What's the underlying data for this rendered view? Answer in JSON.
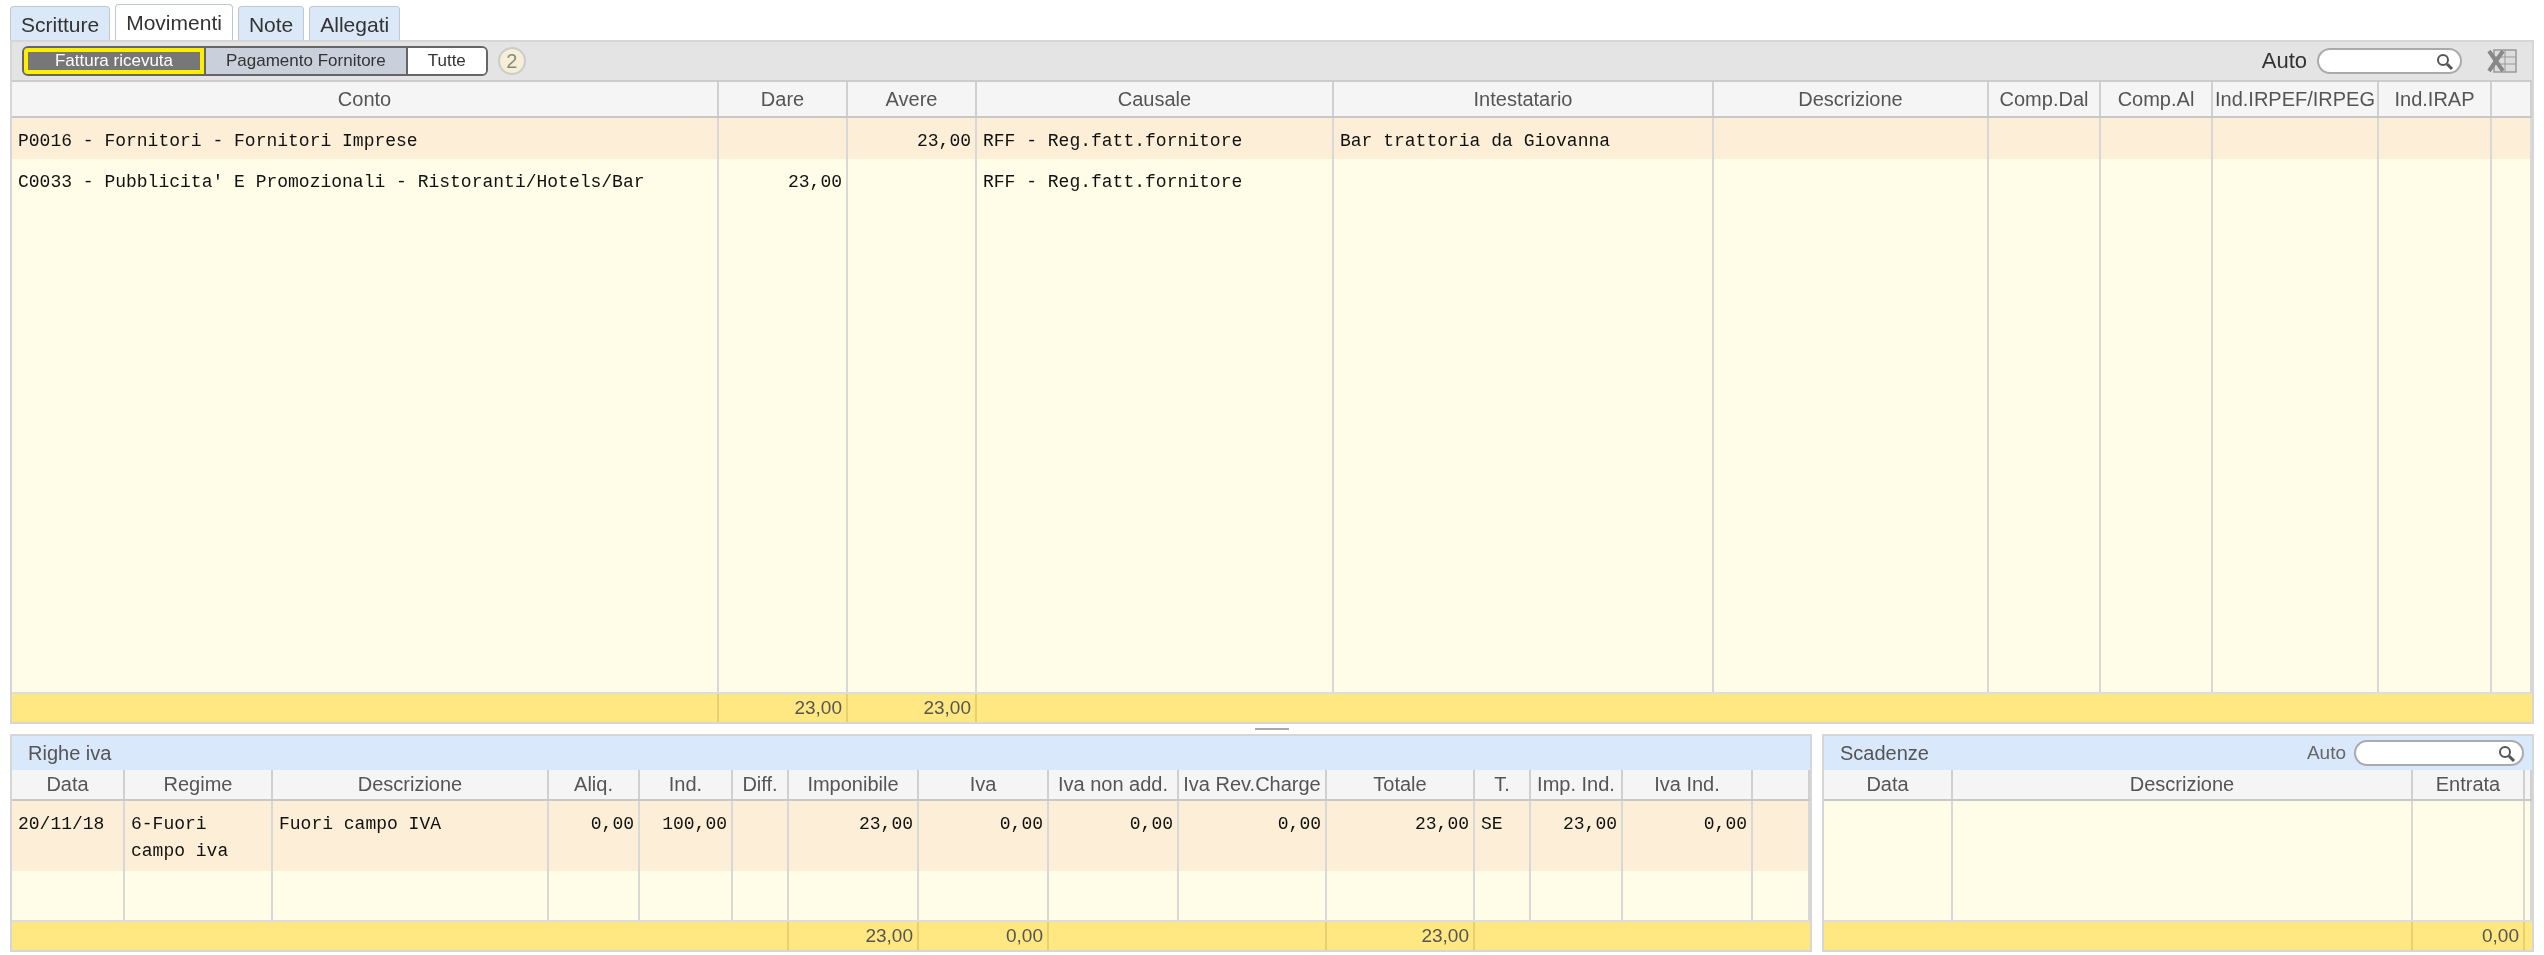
{
  "tabs": [
    {
      "label": "Scritture",
      "selected": false
    },
    {
      "label": "Movimenti",
      "selected": true
    },
    {
      "label": "Note",
      "selected": false
    },
    {
      "label": "Allegati",
      "selected": false
    }
  ],
  "filters": [
    {
      "label": "Fattura ricevuta",
      "selected": true
    },
    {
      "label": "Pagamento Fornitore",
      "selected": false
    },
    {
      "label": "Tutte",
      "selected": false
    }
  ],
  "count_badge": "2",
  "search": {
    "label": "Auto"
  },
  "movements": {
    "columns": [
      {
        "label": "Conto",
        "kind": "text"
      },
      {
        "label": "Dare",
        "kind": "amount",
        "total": "23,00"
      },
      {
        "label": "Avere",
        "kind": "amount",
        "total": "23,00"
      },
      {
        "label": "Causale",
        "kind": "text"
      },
      {
        "label": "Intestatario",
        "kind": "text"
      },
      {
        "label": "Descrizione"
      },
      {
        "label": "Comp.Dal"
      },
      {
        "label": "Comp.Al"
      },
      {
        "label": "Ind.IRPEF/IRPEG"
      },
      {
        "label": "Ind.IRAP"
      }
    ],
    "rows": [
      {
        "selected": true,
        "cells": [
          "P0016 - Fornitori - Fornitori Imprese",
          null,
          "23,00",
          "RFF - Reg.fatt.fornitore",
          "Bar trattoria da Giovanna"
        ]
      },
      {
        "selected": false,
        "cells": [
          "C0033 - Pubblicita' E Promozionali - Ristoranti/Hotels/Bar",
          "23,00",
          null,
          "RFF - Reg.fatt.fornitore"
        ]
      }
    ]
  },
  "vat_lines": {
    "title": "Righe iva",
    "columns": [
      {
        "label": "Data",
        "kind": "text"
      },
      {
        "label": "Regime",
        "kind": "text"
      },
      {
        "label": "Descrizione",
        "kind": "text"
      },
      {
        "label": "Aliq.",
        "kind": "amount"
      },
      {
        "label": "Ind.",
        "kind": "amount"
      },
      {
        "label": "Diff."
      },
      {
        "label": "Imponibile",
        "kind": "amount",
        "total": "23,00"
      },
      {
        "label": "Iva",
        "kind": "amount",
        "total": "0,00"
      },
      {
        "label": "Iva non add.",
        "kind": "amount"
      },
      {
        "label": "Iva Rev.Charge",
        "kind": "amount"
      },
      {
        "label": "Totale",
        "kind": "amount",
        "total": "23,00"
      },
      {
        "label": "T.",
        "kind": "text"
      },
      {
        "label": "Imp. Ind.",
        "kind": "amount"
      },
      {
        "label": "Iva Ind.",
        "kind": "amount"
      }
    ],
    "rows": [
      {
        "selected": true,
        "cells": [
          "20/11/18",
          "6-Fuori campo iva",
          "Fuori campo IVA",
          "0,00",
          "100,00",
          null,
          "23,00",
          "0,00",
          "0,00",
          "0,00",
          "23,00",
          "SE",
          "23,00",
          "0,00"
        ]
      }
    ]
  },
  "deadlines": {
    "title": "Scadenze",
    "search": {
      "label": "Auto"
    },
    "columns": [
      {
        "label": "Data"
      },
      {
        "label": "Descrizione"
      },
      {
        "label": "Entrata",
        "total": "0,00"
      }
    ]
  }
}
